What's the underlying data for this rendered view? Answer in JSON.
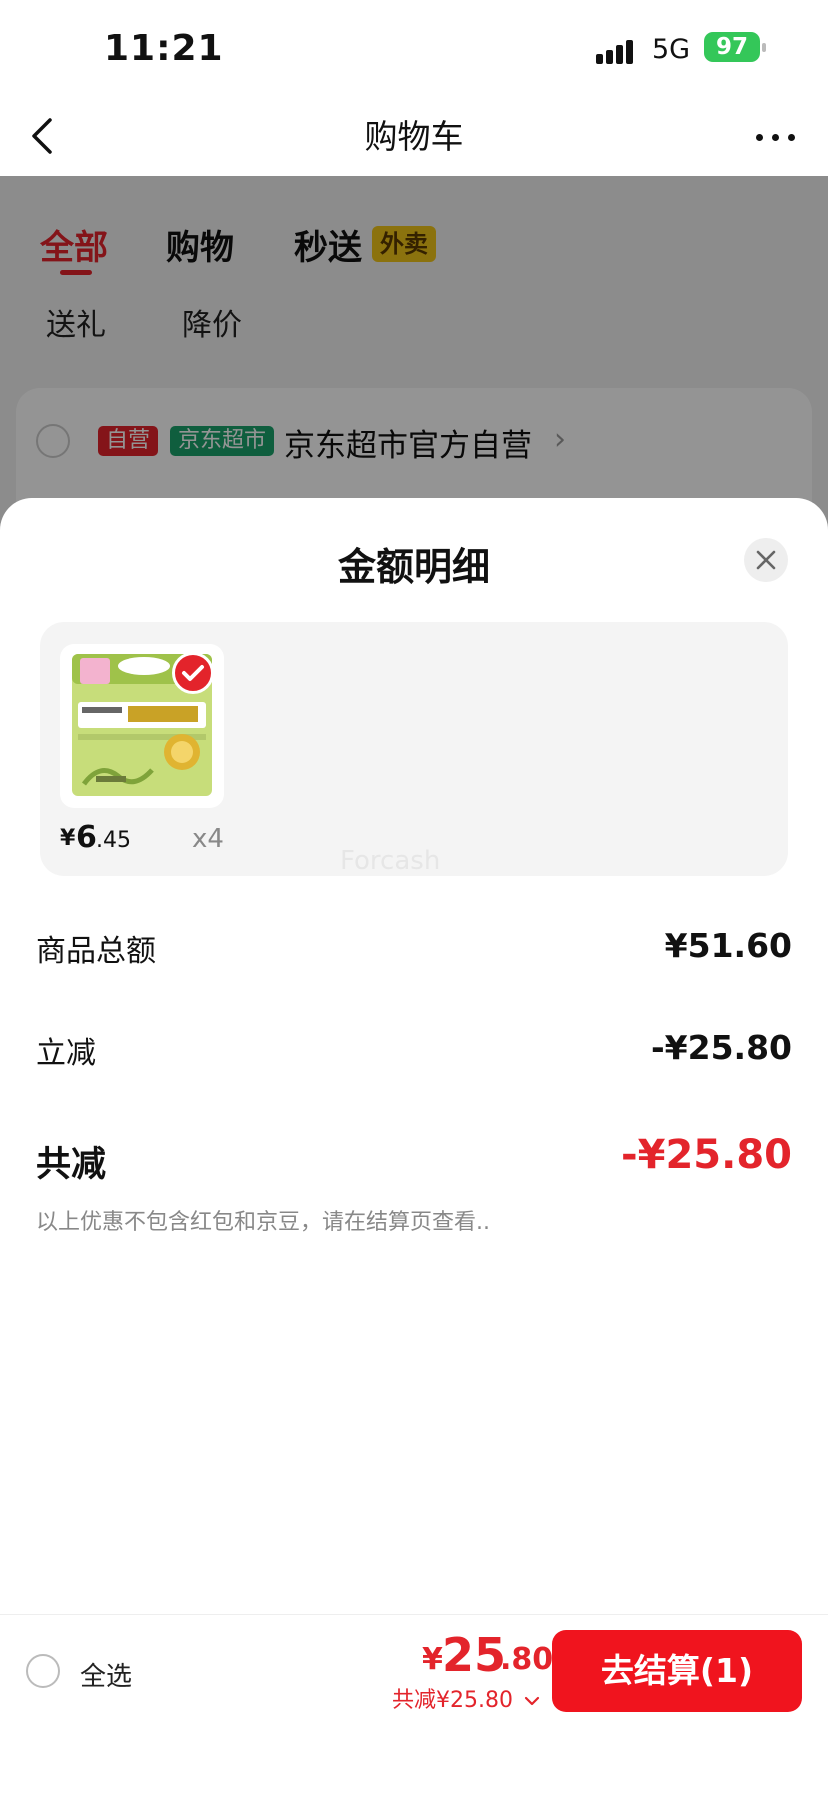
{
  "status_bar": {
    "time": "11:21",
    "network": "5G",
    "battery": "97"
  },
  "nav": {
    "title": "购物车"
  },
  "cart_tabs": {
    "all": "全部",
    "shopping": "购物",
    "express": "秒送",
    "takeout_badge": "外卖",
    "gift": "送礼",
    "price_drop": "降价"
  },
  "store": {
    "self_badge": "自营",
    "mart_badge": "京东超市",
    "name": "京东超市官方自营"
  },
  "sheet": {
    "title": "金额明细",
    "product": {
      "price_symbol": "¥",
      "price_int": "6",
      "price_dec": ".45",
      "quantity": "x4"
    },
    "watermark": "Forcash",
    "rows": {
      "goods_total_label": "商品总额",
      "goods_total_value": "¥51.60",
      "instant_cut_label": "立减",
      "instant_cut_value": "-¥25.80",
      "total_cut_label": "共减",
      "total_cut_value": "-¥25.80"
    },
    "note": "以上优惠不包含红包和京豆，请在结算页查看.."
  },
  "bottom_bar": {
    "select_all": "全选",
    "total_symbol": "¥",
    "total_int": "25",
    "total_dec": ".80",
    "saved": "共减¥25.80",
    "checkout": "去结算(1)"
  },
  "colors": {
    "accent": "#e3242b",
    "checkout": "#f0141e",
    "mart_green": "#1aa36b",
    "battery": "#34c759"
  }
}
